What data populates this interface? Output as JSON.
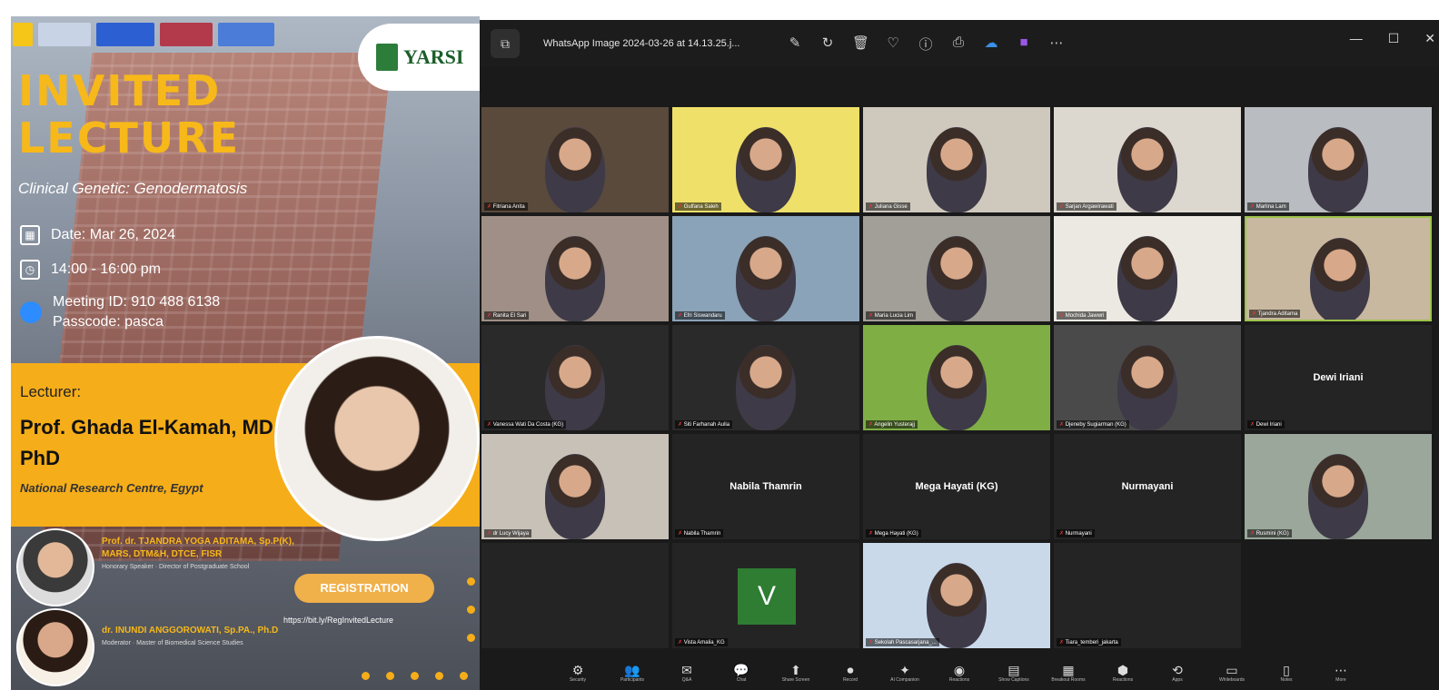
{
  "poster": {
    "heading_line1": "INVITED",
    "heading_line2": "LECTURE",
    "subtitle": "Clinical Genetic: Genodermatosis",
    "date": "Date: Mar 26, 2024",
    "time": "14:00 - 16:00 pm",
    "meeting_id": "Meeting ID: 910 488 6138",
    "passcode": "Passcode: pasca",
    "logo_text": "YARSI",
    "lecturer_label": "Lecturer:",
    "lecturer_name": "Prof. Ghada El-Kamah, MD, PhD",
    "lecturer_affiliation": "National Research Centre, Egypt",
    "speakers": [
      {
        "name": "Prof. dr. TJANDRA YOGA ADITAMA, Sp.P(K), MARS, DTM&H, DTCE, FISR",
        "role": "Honorary Speaker · Director of Postgraduate School"
      },
      {
        "name": "dr. INUNDI ANGGOROWATI, Sp.PA., Ph.D",
        "role": "Moderator · Master of Biomedical Science Studies"
      }
    ],
    "registration_label": "REGISTRATION",
    "registration_url": "https://bit.ly/RegInvitedLecture"
  },
  "meeting": {
    "window_title": "WhatsApp Image 2024-03-26 at 14.13.25.j...",
    "tiles": [
      {
        "label": "Fitriana Anita",
        "bg": "#5a4a3c"
      },
      {
        "label": "Gulfana Saleh",
        "bg": "#efe06a"
      },
      {
        "label": "Juliana Gisse",
        "bg": "#cfc8bd"
      },
      {
        "label": "Sarjan Argawirawati",
        "bg": "#ddd8cf"
      },
      {
        "label": "Marlina Lam",
        "bg": "#b9bcc0"
      },
      {
        "label": "Ranita El Sari",
        "bg": "#9f8f86"
      },
      {
        "label": "Efri Siswandaru",
        "bg": "#8aa3b8"
      },
      {
        "label": "Maria Lucia Lim",
        "bg": "#a29e98"
      },
      {
        "label": "Mochida Jawwri",
        "bg": "#ece9e3"
      },
      {
        "label": "Tjandra Aditama",
        "bg": "#c9b8a0"
      },
      {
        "label": "Vanessa Wati Da Costa (KG)",
        "bg": "#2a2a2a"
      },
      {
        "label": "Siti Farhanah Aulia",
        "bg": "#2a2a2a"
      },
      {
        "label": "Angelin Yusterajj",
        "bg": "#7fae45"
      },
      {
        "label": "Djeneby Sugiarman (KG)",
        "bg": "#4a4a4a"
      },
      {
        "label": "Dewi Iriani",
        "center": "Dewi Iriani",
        "bg": "#242424"
      },
      {
        "label": "dr Lucy Wijaya",
        "bg": "#c7c1b8"
      },
      {
        "label": "Nabila Thamrin",
        "center": "Nabila Thamrin",
        "bg": "#242424"
      },
      {
        "label": "Mega Hayati (KG)",
        "center": "Mega Hayati (KG)",
        "bg": "#242424"
      },
      {
        "label": "Nurmayani",
        "center": "Nurmayani",
        "bg": "#242424"
      },
      {
        "label": "Rusmini (KG)",
        "bg": "#9aa79a"
      },
      {
        "label": "",
        "bg": "#242424"
      },
      {
        "label": "Vista Amalia_KG",
        "avatar": "V",
        "bg": "#242424"
      },
      {
        "label": "Sekolah Pascasarjana_...",
        "bg": "#c9d9ea"
      },
      {
        "label": "Tiara_temberi_jakarta",
        "bg": "#242424"
      }
    ],
    "toolbar": [
      {
        "icon": "⚙",
        "label": "Security"
      },
      {
        "icon": "👥",
        "label": "Participants"
      },
      {
        "icon": "✉",
        "label": "Q&A"
      },
      {
        "icon": "💬",
        "label": "Chat"
      },
      {
        "icon": "⬆",
        "label": "Share Screen"
      },
      {
        "icon": "⏺",
        "label": "Record"
      },
      {
        "icon": "✦",
        "label": "AI Companion"
      },
      {
        "icon": "◉",
        "label": "Reactions"
      },
      {
        "icon": "▤",
        "label": "Show Captions"
      },
      {
        "icon": "▦",
        "label": "Breakout Rooms"
      },
      {
        "icon": "⬢",
        "label": "Reactions"
      },
      {
        "icon": "⟲",
        "label": "Apps"
      },
      {
        "icon": "▭",
        "label": "Whiteboards"
      },
      {
        "icon": "▯",
        "label": "Notes"
      },
      {
        "icon": "⋯",
        "label": "More"
      }
    ]
  }
}
